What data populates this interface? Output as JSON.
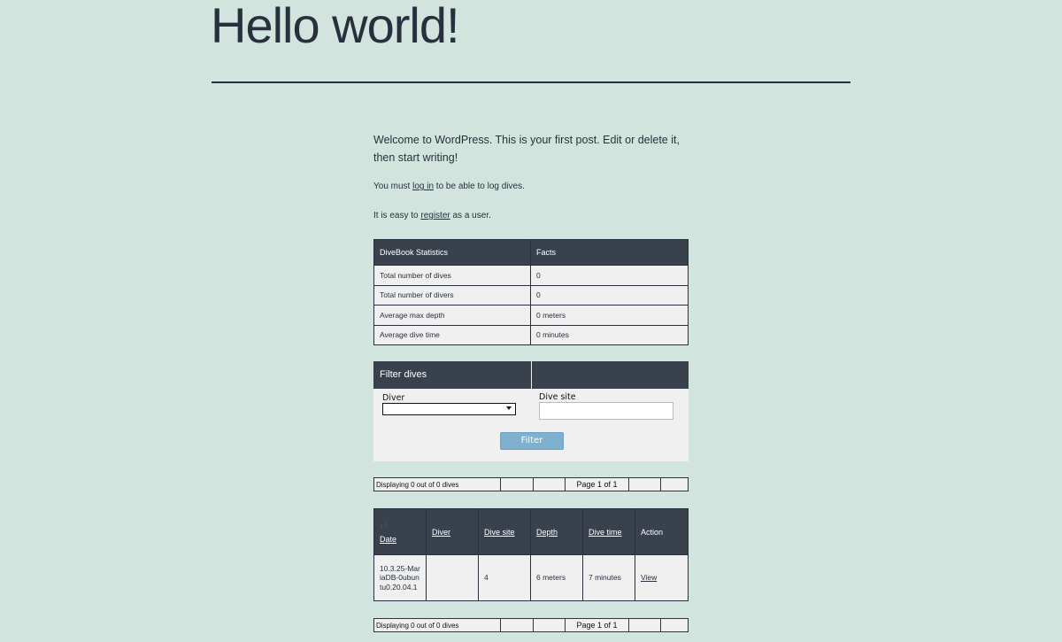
{
  "post": {
    "title": "Hello world!",
    "intro": "Welcome to WordPress. This is your first post. Edit or delete it, then start writing!"
  },
  "notices": {
    "login_prefix": "You must ",
    "login_link": "log in",
    "login_suffix": " to be able to log dives.",
    "register_prefix": "It is easy to ",
    "register_link": "register",
    "register_suffix": " as a user."
  },
  "stats": {
    "headers": [
      "DiveBook Statistics",
      "Facts"
    ],
    "rows": [
      [
        "Total number of dives",
        "0"
      ],
      [
        "Total number of divers",
        "0"
      ],
      [
        "Average max depth",
        "0 meters"
      ],
      [
        "Average dive time",
        "0 minutes"
      ]
    ]
  },
  "filter": {
    "title": "Filter dives",
    "diver_label": "Diver",
    "diver_value": "",
    "site_label": "Dive site",
    "site_value": "",
    "button": "Filter"
  },
  "pager": {
    "displaying": "Displaying 0 out of 0 dives",
    "page": "Page 1 of 1"
  },
  "dives": {
    "sort_icon": "sort-icon",
    "headers": [
      "Date",
      "Diver",
      "Dive site",
      "Depth",
      "Dive time",
      "Action"
    ],
    "rows": [
      {
        "date": "10.3.25-MariaDB-0ubuntu0.20.04.1",
        "diver": "",
        "site": "4",
        "depth": "6 meters",
        "time": "7 minutes",
        "action": "View"
      }
    ]
  },
  "colors": {
    "background": "#d1e4dd",
    "text": "#28303d",
    "header": "#39414d",
    "button": "#7fb0d0"
  }
}
